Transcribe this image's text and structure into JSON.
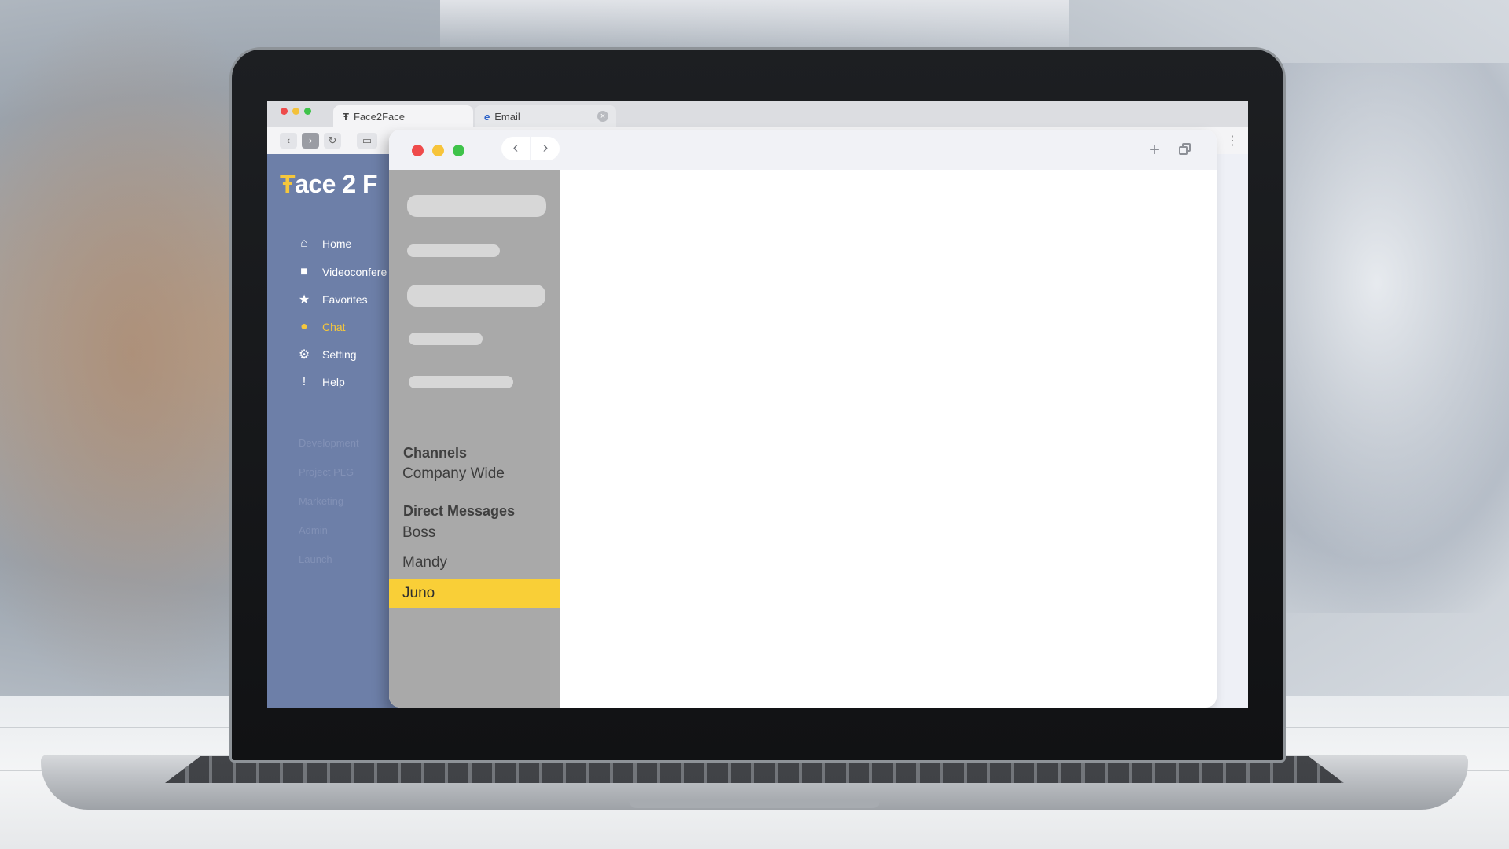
{
  "outer_browser": {
    "tabs": [
      {
        "icon": "Ŧ",
        "label": "Face2Face"
      },
      {
        "icon": "e",
        "label": "Email"
      }
    ],
    "menu_icon": "⋮"
  },
  "app": {
    "logo": {
      "mark": "Ŧ",
      "text": "ace 2 F"
    },
    "menu": [
      {
        "icon": "home-icon",
        "glyph": "⌂",
        "label": "Home"
      },
      {
        "icon": "video-icon",
        "glyph": "■",
        "label": "Videoconfere"
      },
      {
        "icon": "star-icon",
        "glyph": "★",
        "label": "Favorites"
      },
      {
        "icon": "chat-icon",
        "glyph": "●",
        "label": "Chat",
        "active": true
      },
      {
        "icon": "gear-icon",
        "glyph": "⚙",
        "label": "Setting"
      },
      {
        "icon": "help-icon",
        "glyph": "!",
        "label": "Help"
      }
    ],
    "workspaces": [
      "Development",
      "Project PLG",
      "Marketing",
      "Admin",
      "Launch"
    ]
  },
  "chat_window": {
    "nav": {
      "back": "‹",
      "forward": "›",
      "new": "+"
    },
    "channels_header": "Channels",
    "channels": [
      "Company Wide"
    ],
    "dm_header": "Direct Messages",
    "direct_messages": [
      "Boss",
      "Mandy",
      "Juno"
    ],
    "selected": "Juno"
  },
  "colors": {
    "sidebar": "#6d7fa8",
    "accent": "#f9cf37",
    "chat_sidebar": "#a9a9a9",
    "close": "#ef4b4b",
    "minimize": "#f7c43a",
    "maximize": "#3fc34a"
  }
}
